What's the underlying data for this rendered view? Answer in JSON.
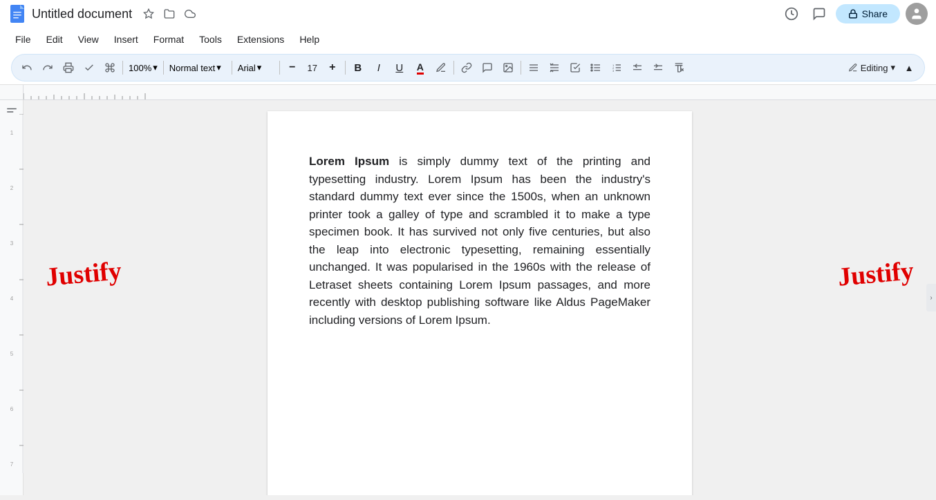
{
  "app": {
    "title": "Untitled document",
    "doc_icon_color": "#4285f4"
  },
  "title_bar": {
    "title": "Untitled document",
    "star_icon": "★",
    "folder_icon": "📁",
    "cloud_icon": "☁"
  },
  "top_right": {
    "history_icon": "🕐",
    "comment_icon": "💬",
    "share_label": "Share",
    "lock_icon": "🔒"
  },
  "menu": {
    "items": [
      "File",
      "Edit",
      "View",
      "Insert",
      "Format",
      "Tools",
      "Extensions",
      "Help"
    ]
  },
  "toolbar": {
    "undo_icon": "↩",
    "redo_icon": "↪",
    "print_icon": "🖨",
    "spell_icon": "✓",
    "paint_icon": "🖌",
    "zoom_value": "100%",
    "style_value": "Normal text",
    "font_value": "Arial",
    "font_size_minus": "−",
    "font_size_value": "17",
    "font_size_plus": "+",
    "bold_label": "B",
    "italic_label": "I",
    "underline_label": "U",
    "text_color_icon": "A",
    "highlight_icon": "✏",
    "link_icon": "🔗",
    "comment_icon": "💬",
    "image_icon": "🖼",
    "align_icon": "≡",
    "line_spacing_icon": "↕",
    "list_icon": "☰",
    "bullet_icon": "•",
    "numbered_icon": "1.",
    "indent_dec_icon": "←",
    "indent_inc_icon": "→",
    "clear_format_icon": "✕",
    "editing_label": "Editing",
    "chevron_down": "▾"
  },
  "annotations": {
    "left": "Justify",
    "right": "Justify",
    "color": "#e00000"
  },
  "document": {
    "content_bold": "Lorem Ipsum",
    "content_body": " is simply dummy text of the printing and typesetting industry. Lorem Ipsum has been the industry's standard dummy text ever since the 1500s, when an unknown printer took a galley of type and scrambled it to make a type specimen book. It has survived not only five centuries, but also the leap into electronic typesetting, remaining essentially unchanged. It was popularised in the 1960s with the release of Letraset sheets containing Lorem Ipsum passages, and more recently with desktop publishing software like Aldus PageMaker including versions of Lorem Ipsum."
  }
}
